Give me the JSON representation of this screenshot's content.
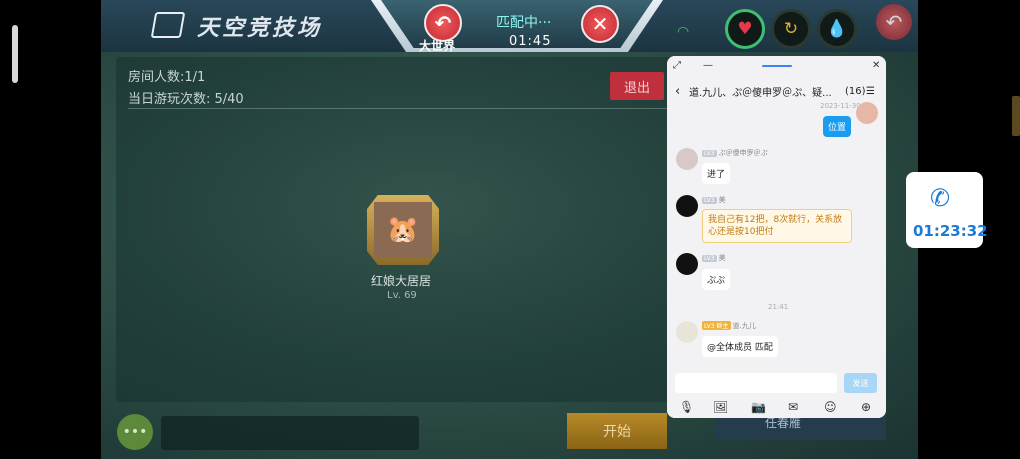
{
  "game": {
    "title": "天空竞技场",
    "matching_label": "匹配中···",
    "timer": "01:45",
    "world_label": "大世界",
    "room_count": "房间人数:1/1",
    "daily_plays": "当日游玩次数: 5/40",
    "quit_label": "退出",
    "player_name": "红娘大居居",
    "player_level": "Lv. 69",
    "start_label": "开始",
    "bottom_card_label": "任春雁",
    "chat_dots": "•••"
  },
  "chat": {
    "title": "道.九儿、ぷ＠傻申罗＠ぷ、疑...",
    "member_count": "(16)",
    "timestamp_top": "2023-11-30",
    "timestamp_mid": "21:41",
    "messages": [
      {
        "side": "right",
        "text": "位置"
      },
      {
        "side": "left",
        "level_tag": "LV3",
        "name": "ぷ＠傻申罗＠ぷ",
        "text": "进了"
      },
      {
        "side": "left",
        "level_tag": "LV3",
        "name": "美",
        "text": "我自己有12把，8次就行，关系放心还是按10把付"
      },
      {
        "side": "left",
        "level_tag": "LV3",
        "name": "美",
        "text": "ぷぷ"
      },
      {
        "side": "left",
        "level_tag": "LV3 群主",
        "name": "道.九儿",
        "text": "@全体成员 匹配"
      }
    ],
    "send_label": "发送"
  },
  "call": {
    "duration": "01:23:32"
  },
  "colors": {
    "accent_blue": "#1a9cf0",
    "call_blue": "#1a7bd6",
    "quit_red": "#c0303c",
    "start_gold": "#b88a2a"
  }
}
